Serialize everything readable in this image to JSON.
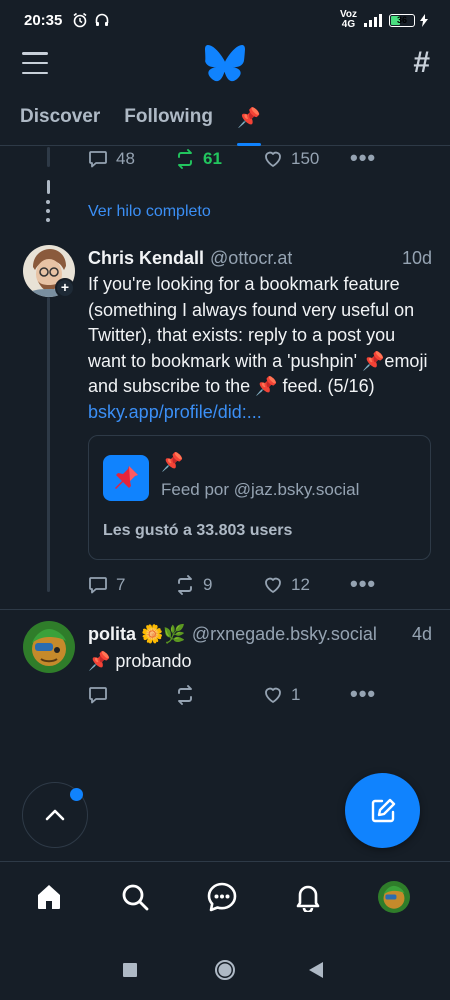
{
  "status_bar": {
    "time": "20:35",
    "network_label": "Voz\n4G",
    "signal": "4G",
    "battery": "36"
  },
  "header": {
    "menu_icon": "hamburger-menu-icon",
    "logo_icon": "butterfly-logo-icon",
    "feeds_icon": "hash-icon"
  },
  "tabs": [
    {
      "label": "Discover",
      "active": false
    },
    {
      "label": "Following",
      "active": false
    },
    {
      "label": "📌",
      "active": true
    }
  ],
  "prev_post_actions": {
    "replies": "48",
    "reposts": "61",
    "likes": "150"
  },
  "see_thread": "Ver hilo completo",
  "post1": {
    "name": "Chris Kendall",
    "handle": "@ottocr.at",
    "time": "10d",
    "text": "If you're looking for a bookmark feature (something I always found very useful on Twitter), that exists: reply to a post you want to bookmark with a 'pushpin' 📌emoji and subscribe to the 📌 feed. (5/16) ",
    "link": "bsky.app/profile/did:...",
    "embed": {
      "title": "📌",
      "by": "Feed por @jaz.bsky.social",
      "likes": "Les gustó a 33.803 users"
    },
    "replies": "7",
    "reposts": "9",
    "likes": "12"
  },
  "post2": {
    "name": "polita 🌼🌿",
    "handle": "@rxnegade.bsky.social",
    "time": "4d",
    "text": "📌 probando",
    "replies": "",
    "reposts": "",
    "likes": "1"
  },
  "colors": {
    "background": "#161e27",
    "accent": "#1083fe",
    "repost_active": "#22c55e",
    "muted": "#95a3b2"
  }
}
